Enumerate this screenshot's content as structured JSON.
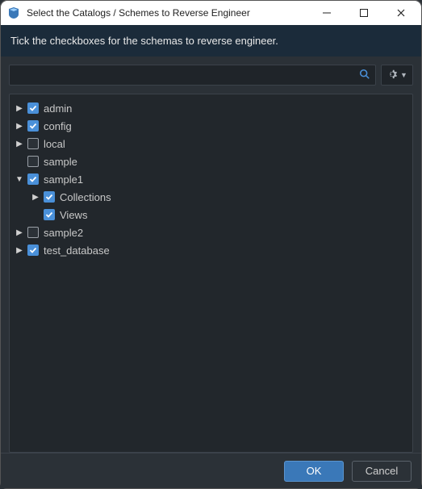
{
  "titlebar": {
    "title": "Select the Catalogs / Schemes to Reverse Engineer"
  },
  "header": {
    "instruction": "Tick the checkboxes for the schemas to reverse engineer."
  },
  "search": {
    "value": "",
    "placeholder": ""
  },
  "tree": {
    "nodes": [
      {
        "depth": 0,
        "expand": "closed",
        "checked": true,
        "label": "admin"
      },
      {
        "depth": 0,
        "expand": "closed",
        "checked": true,
        "label": "config"
      },
      {
        "depth": 0,
        "expand": "closed",
        "checked": false,
        "label": "local"
      },
      {
        "depth": 0,
        "expand": "none",
        "checked": false,
        "label": "sample"
      },
      {
        "depth": 0,
        "expand": "open",
        "checked": true,
        "label": "sample1"
      },
      {
        "depth": 1,
        "expand": "closed",
        "checked": true,
        "label": "Collections"
      },
      {
        "depth": 1,
        "expand": "none",
        "checked": true,
        "label": "Views"
      },
      {
        "depth": 0,
        "expand": "closed",
        "checked": false,
        "label": "sample2"
      },
      {
        "depth": 0,
        "expand": "closed",
        "checked": true,
        "label": "test_database"
      }
    ]
  },
  "footer": {
    "ok": "OK",
    "cancel": "Cancel"
  },
  "icons": {
    "app": "app-icon",
    "minimize": "minimize-icon",
    "maximize": "maximize-icon",
    "close": "close-icon",
    "search": "search-icon",
    "gear": "gear-icon",
    "caret_down": "caret-down-icon"
  },
  "colors": {
    "accent": "#4a90d9",
    "dark_bg": "#2b3137",
    "panel_bg": "#22272c",
    "header_bg": "#1b2b3a"
  }
}
